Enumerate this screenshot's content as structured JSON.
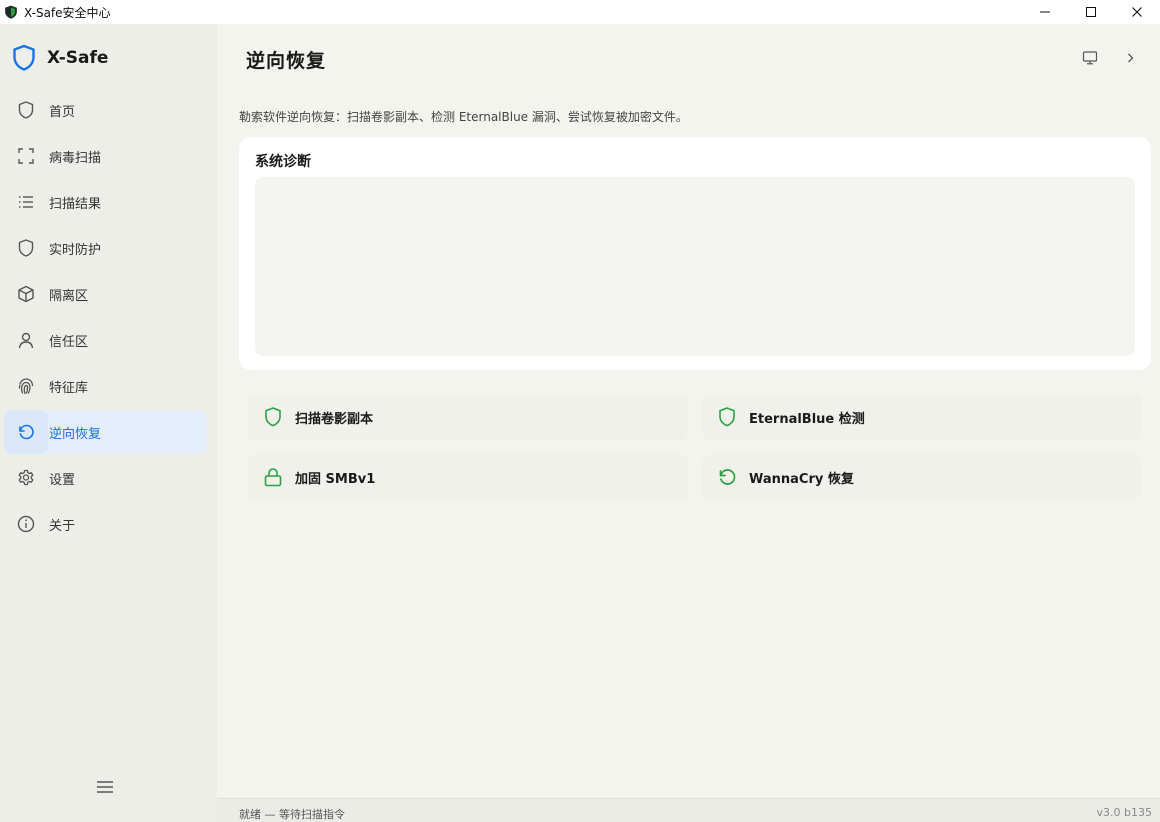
{
  "window": {
    "title": "X-Safe安全中心"
  },
  "colors": {
    "accent": "#1a73e8",
    "icon_green": "#2ea043",
    "brand_blue": "#1a73e8"
  },
  "sidebar": {
    "brand": "X-Safe",
    "items": [
      {
        "label": "首页",
        "icon": "shield-icon"
      },
      {
        "label": "病毒扫描",
        "icon": "scan-frame-icon"
      },
      {
        "label": "扫描结果",
        "icon": "list-icon"
      },
      {
        "label": "实时防护",
        "icon": "shield-icon"
      },
      {
        "label": "隔离区",
        "icon": "box-icon"
      },
      {
        "label": "信任区",
        "icon": "user-icon"
      },
      {
        "label": "特征库",
        "icon": "fingerprint-icon"
      },
      {
        "label": "逆向恢复",
        "icon": "restore-icon",
        "active": true
      },
      {
        "label": "设置",
        "icon": "gear-icon"
      },
      {
        "label": "关于",
        "icon": "info-icon"
      }
    ]
  },
  "main": {
    "title": "逆向恢复",
    "description": "勒索软件逆向恢复：扫描卷影副本、检测 EternalBlue 漏洞、尝试恢复被加密文件。",
    "diagnosis": {
      "title": "系统诊断"
    },
    "actions": [
      {
        "label": "扫描卷影副本",
        "icon": "shield-icon"
      },
      {
        "label": "EternalBlue 检测",
        "icon": "shield-icon"
      },
      {
        "label": "加固 SMBv1",
        "icon": "lock-icon"
      },
      {
        "label": "WannaCry 恢复",
        "icon": "restore-icon"
      }
    ]
  },
  "statusbar": {
    "text": "就绪 — 等待扫描指令",
    "version": "v3.0 b135"
  }
}
